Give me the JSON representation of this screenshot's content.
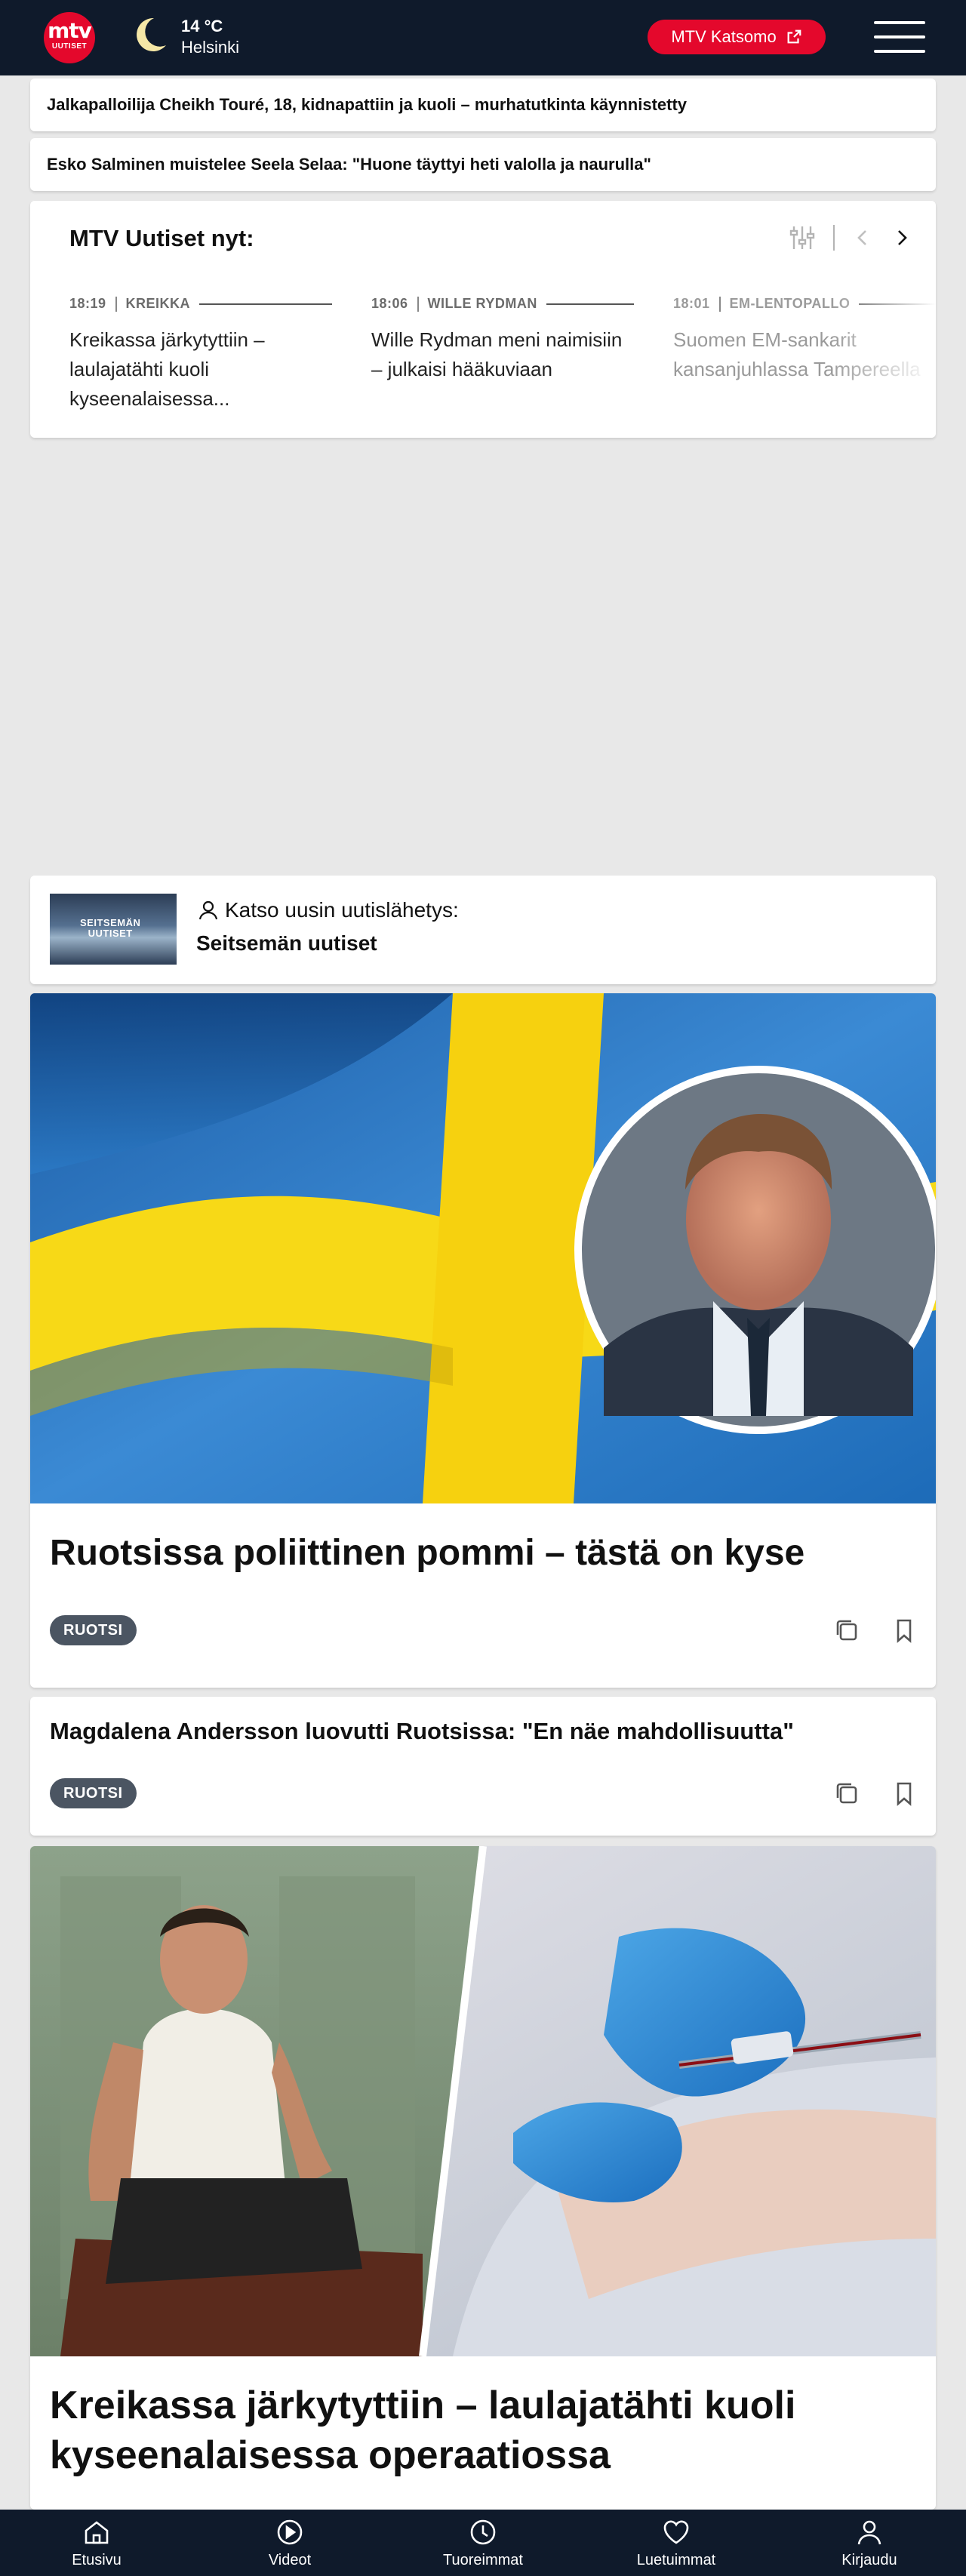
{
  "header": {
    "logo_top": "mtv",
    "logo_bottom": "UUTISET",
    "weather": {
      "temperature": "14 °C",
      "city": "Helsinki",
      "icon": "moon-icon"
    },
    "katsomo_label": "MTV Katsomo",
    "menu_icon": "hamburger-menu-icon"
  },
  "breaking": [
    "Jalkapalloilija Cheikh Touré, 18, kidnapattiin ja kuoli – murhatutkinta käynnistetty",
    "Esko Salminen muistelee Seela Selaa: \"Huone täyttyi heti valolla ja naurulla\""
  ],
  "now": {
    "title": "MTV Uutiset nyt:",
    "items": [
      {
        "time": "18:19",
        "category": "KREIKKA",
        "headline": "Kreikassa järkytyttiin – laulajatähti kuoli kyseenalaisessa..."
      },
      {
        "time": "18:06",
        "category": "WILLE RYDMAN",
        "headline": "Wille Rydman meni naimisiin – julkaisi hääkuviaan"
      },
      {
        "time": "18:01",
        "category": "EM-LENTOPALLO",
        "headline": "Suomen EM-sankarit kansanjuhlassa Tampereella"
      }
    ]
  },
  "broadcast": {
    "thumb_label_1": "SEITSEMÄN",
    "thumb_label_2": "UUTISET",
    "kicker": "Katso uusin uutislähetys:",
    "title": "Seitsemän uutiset"
  },
  "articles": [
    {
      "title": "Ruotsissa poliittinen pommi – tästä on kyse",
      "tag": "RUOTSI"
    },
    {
      "title": "Magdalena Andersson luovutti Ruotsissa: \"En näe mahdollisuutta\"",
      "tag": "RUOTSI"
    },
    {
      "title_line1": "Kreikassa järkytyttiin – laulajatähti kuoli",
      "title_line2": "kyseenalaisessa operaatiossa"
    }
  ],
  "bottom_nav": [
    {
      "label": "Etusivu",
      "icon": "home-icon"
    },
    {
      "label": "Videot",
      "icon": "play-icon"
    },
    {
      "label": "Tuoreimmat",
      "icon": "clock-icon"
    },
    {
      "label": "Luetuimmat",
      "icon": "heart-icon"
    },
    {
      "label": "Kirjaudu",
      "icon": "user-icon"
    }
  ],
  "colors": {
    "brand_red": "#e4082c",
    "header_bg": "#0f1a2b",
    "tag_bg": "#4b5562",
    "page_bg": "#e8e8e8"
  }
}
